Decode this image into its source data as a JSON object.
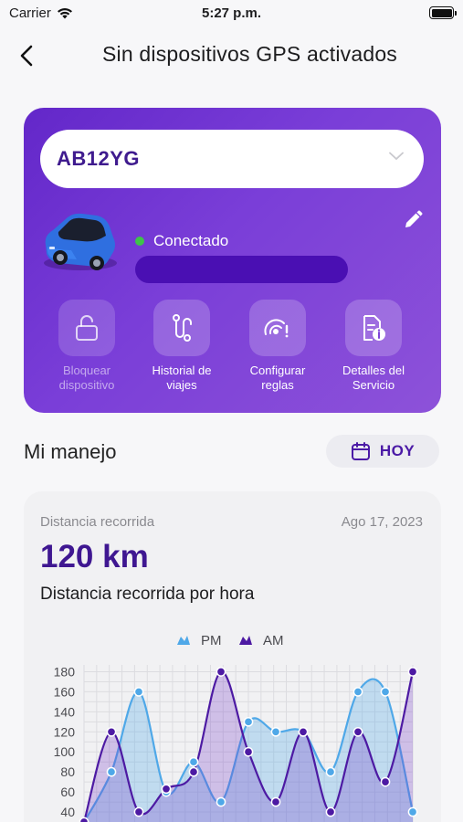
{
  "status_bar": {
    "carrier": "Carrier",
    "time": "5:27 p.m."
  },
  "nav": {
    "title": "Sin dispositivos GPS activados"
  },
  "device": {
    "plate": "AB12YG",
    "connection_status": "Conectado",
    "status_color": "#3ec34a",
    "actions": [
      {
        "label": "Bloquear\ndispositivo",
        "icon": "unlock-icon",
        "enabled": false
      },
      {
        "label": "Historial de\nviajes",
        "icon": "route-icon",
        "enabled": true
      },
      {
        "label": "Configurar\nreglas",
        "icon": "signal-rules-icon",
        "enabled": true
      },
      {
        "label": "Detalles del\nServicio",
        "icon": "document-info-icon",
        "enabled": true
      }
    ]
  },
  "driving": {
    "title": "Mi manejo",
    "date_button": "HOY",
    "stat_label": "Distancia recorrida",
    "stat_date": "Ago 17, 2023",
    "stat_value": "120 km",
    "chart_title": "Distancia recorrida por hora"
  },
  "chart_data": {
    "type": "area",
    "title": "Distancia recorrida por hora",
    "legend_position": "top-center",
    "y_ticks": [
      40,
      60,
      80,
      100,
      120,
      140,
      160,
      180
    ],
    "ylim": [
      30,
      185
    ],
    "grid": true,
    "series": [
      {
        "name": "PM",
        "color": "#4fa8e8",
        "values": [
          30,
          80,
          160,
          60,
          90,
          50,
          130,
          120,
          120,
          80,
          160,
          160,
          40
        ]
      },
      {
        "name": "AM",
        "color": "#4d1aa3",
        "values": [
          30,
          120,
          40,
          63,
          80,
          180,
          100,
          50,
          120,
          40,
          120,
          70,
          180
        ]
      }
    ]
  }
}
